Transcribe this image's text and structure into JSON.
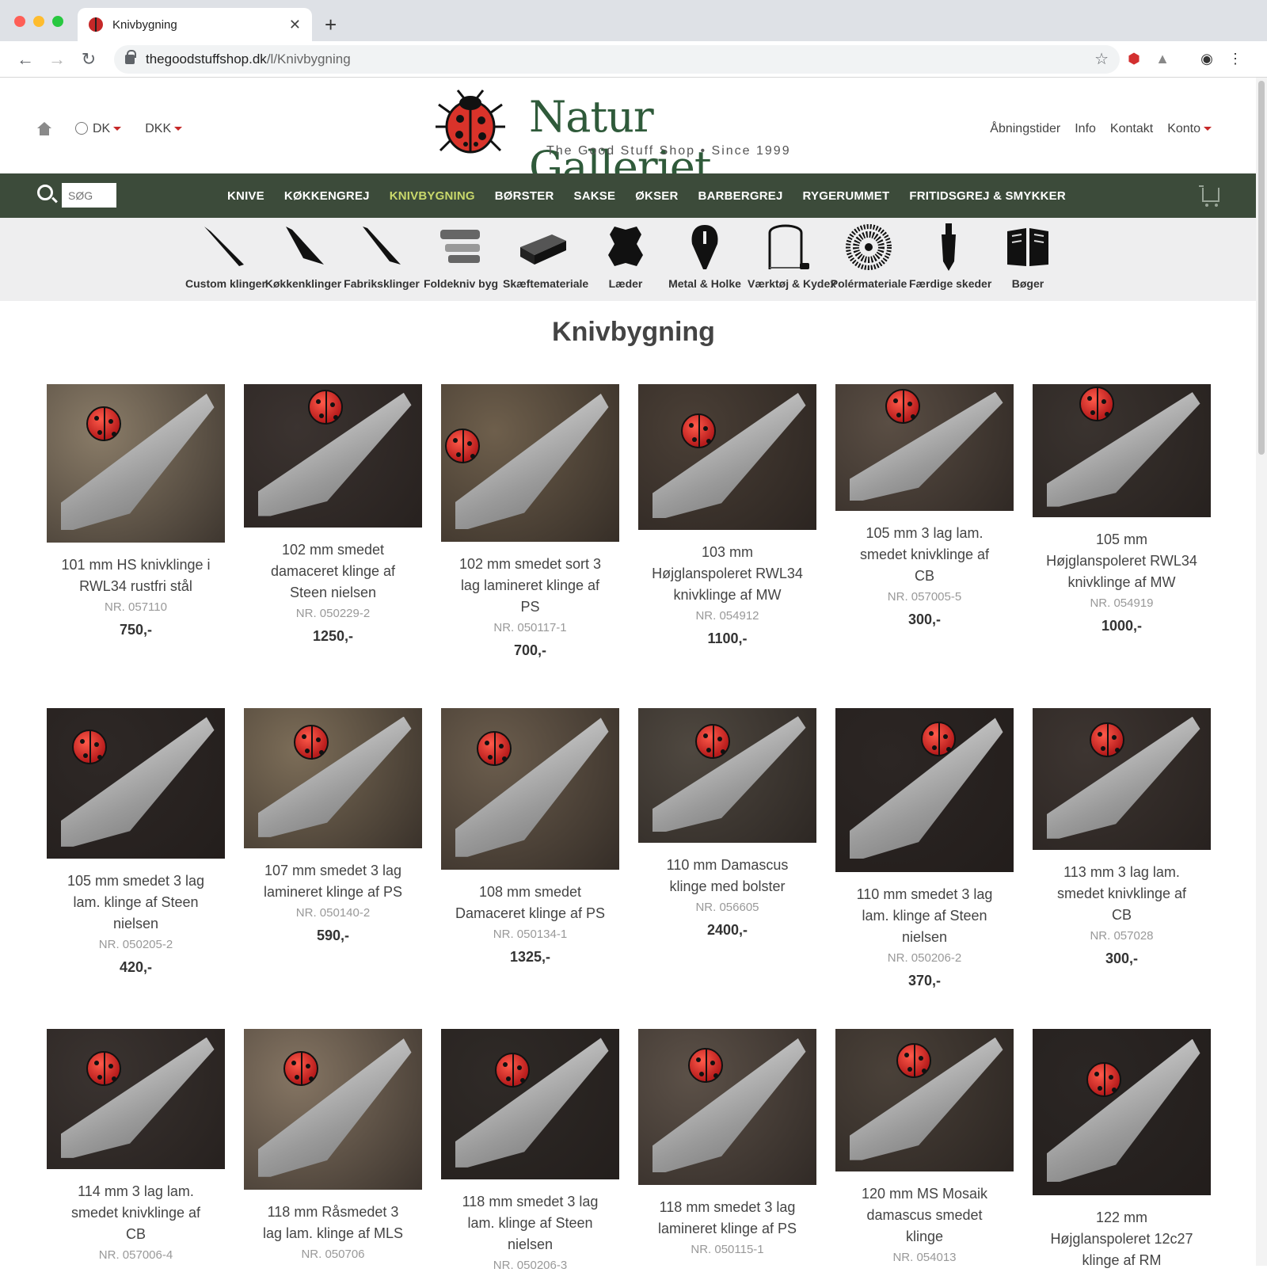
{
  "browser": {
    "tab_title": "Knivbygning",
    "url_host": "thegoodstuffshop.dk",
    "url_path": "/l/Knivbygning"
  },
  "header": {
    "country": "DK",
    "currency": "DKK",
    "logo_title": "Natur Galleriet",
    "logo_subtitle": "The Good Stuff Shop  •  Since 1999",
    "links": [
      "Åbningstider",
      "Info",
      "Kontakt",
      "Konto"
    ]
  },
  "nav": {
    "search_placeholder": "SØG",
    "items": [
      "KNIVE",
      "KØKKENGREJ",
      "KNIVBYGNING",
      "BØRSTER",
      "SAKSE",
      "ØKSER",
      "BARBERGREJ",
      "RYGERUMMET",
      "FRITIDSGREJ & SMYKKER"
    ],
    "active_index": 2
  },
  "subcategories": [
    {
      "label": "Custom klinger",
      "icon": "blade-icon"
    },
    {
      "label": "Køkkenklinger",
      "icon": "kitchen-blade-icon"
    },
    {
      "label": "Fabriksklinger",
      "icon": "factory-blade-icon"
    },
    {
      "label": "Foldekniv byg",
      "icon": "folding-knife-icon"
    },
    {
      "label": "Skæftemateriale",
      "icon": "handle-block-icon"
    },
    {
      "label": "Læder",
      "icon": "leather-hide-icon"
    },
    {
      "label": "Metal & Holke",
      "icon": "metal-fitting-icon"
    },
    {
      "label": "Værktøj & Kydex",
      "icon": "saw-icon"
    },
    {
      "label": "Polérmateriale",
      "icon": "polishing-wheel-icon"
    },
    {
      "label": "Færdige skeder",
      "icon": "sheath-icon"
    },
    {
      "label": "Bøger",
      "icon": "book-icon"
    }
  ],
  "page_title": "Knivbygning",
  "products": [
    {
      "name": "101 mm HS knivklinge i RWL34 rustfri stål",
      "nr": "NR. 057110",
      "price": "750,-"
    },
    {
      "name": "102 mm smedet damaceret klinge af Steen nielsen",
      "nr": "NR. 050229-2",
      "price": "1250,-"
    },
    {
      "name": "102 mm smedet sort 3 lag lamineret klinge af PS",
      "nr": "NR. 050117-1",
      "price": "700,-"
    },
    {
      "name": "103 mm Højglanspoleret RWL34 knivklinge af MW",
      "nr": "NR. 054912",
      "price": "1100,-"
    },
    {
      "name": "105 mm 3 lag lam. smedet knivklinge af CB",
      "nr": "NR. 057005-5",
      "price": "300,-"
    },
    {
      "name": "105 mm Højglanspoleret RWL34 knivklinge af MW",
      "nr": "NR. 054919",
      "price": "1000,-"
    },
    {
      "name": "105 mm smedet 3 lag lam. klinge af Steen nielsen",
      "nr": "NR. 050205-2",
      "price": "420,-"
    },
    {
      "name": "107 mm smedet 3 lag lamineret klinge af PS",
      "nr": "NR. 050140-2",
      "price": "590,-"
    },
    {
      "name": "108 mm smedet Damaceret klinge af PS",
      "nr": "NR. 050134-1",
      "price": "1325,-"
    },
    {
      "name": "110 mm Damascus klinge med bolster",
      "nr": "NR. 056605",
      "price": "2400,-"
    },
    {
      "name": "110 mm smedet 3 lag lam. klinge af Steen nielsen",
      "nr": "NR. 050206-2",
      "price": "370,-"
    },
    {
      "name": "113 mm 3 lag lam. smedet knivklinge af CB",
      "nr": "NR. 057028",
      "price": "300,-"
    },
    {
      "name": "114 mm 3 lag lam. smedet knivklinge af CB",
      "nr": "NR. 057006-4",
      "price": ""
    },
    {
      "name": "118 mm Råsmedet 3 lag lam. klinge af MLS",
      "nr": "NR. 050706",
      "price": ""
    },
    {
      "name": "118 mm smedet 3 lag lam. klinge af Steen nielsen",
      "nr": "NR. 050206-3",
      "price": ""
    },
    {
      "name": "118 mm smedet 3 lag lamineret klinge af PS",
      "nr": "NR. 050115-1",
      "price": ""
    },
    {
      "name": "120 mm MS Mosaik damascus smedet klinge",
      "nr": "NR. 054013",
      "price": ""
    },
    {
      "name": "122 mm Højglanspoleret 12c27 klinge af RM",
      "nr": "",
      "price": ""
    }
  ],
  "colors": {
    "nav_bg": "#3c4b3a",
    "nav_active": "#c9d86b",
    "accent_red": "#c62828",
    "logo_green": "#2f5a3a"
  }
}
